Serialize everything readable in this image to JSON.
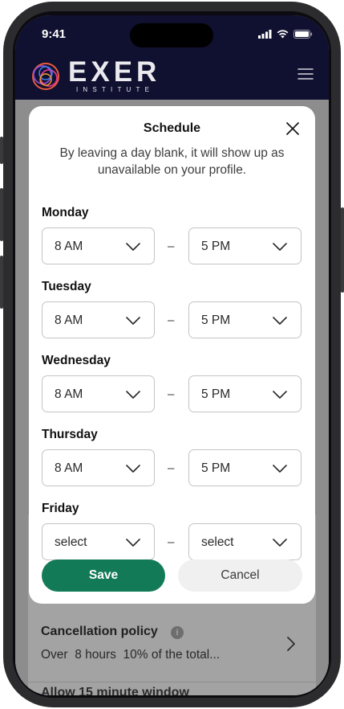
{
  "status": {
    "time": "9:41"
  },
  "brand": {
    "name": "EXER",
    "subtitle": "INSTITUTE",
    "accent": "#137a57"
  },
  "modal": {
    "title": "Schedule",
    "description": "By leaving a day blank, it will show up as unavailable on your profile.",
    "separator": "–",
    "days": [
      {
        "label": "Monday",
        "start": "8 AM",
        "end": "5 PM"
      },
      {
        "label": "Tuesday",
        "start": "8 AM",
        "end": "5 PM"
      },
      {
        "label": "Wednesday",
        "start": "8 AM",
        "end": "5 PM"
      },
      {
        "label": "Thursday",
        "start": "8 AM",
        "end": "5 PM"
      },
      {
        "label": "Friday",
        "start": "select",
        "end": "select"
      }
    ],
    "save_label": "Save",
    "cancel_label": "Cancel"
  },
  "background": {
    "policy_title": "Cancellation policy",
    "policy_info_glyph": "i",
    "policy_summary": "Over  8 hours  10% of the total...",
    "next_row_peek": "Allow 15 minute window"
  },
  "icons": {
    "menu": "hamburger-menu-icon",
    "close": "close-icon",
    "select": "chevron-down-icon",
    "row": "chevron-right-icon",
    "info": "info-icon"
  }
}
